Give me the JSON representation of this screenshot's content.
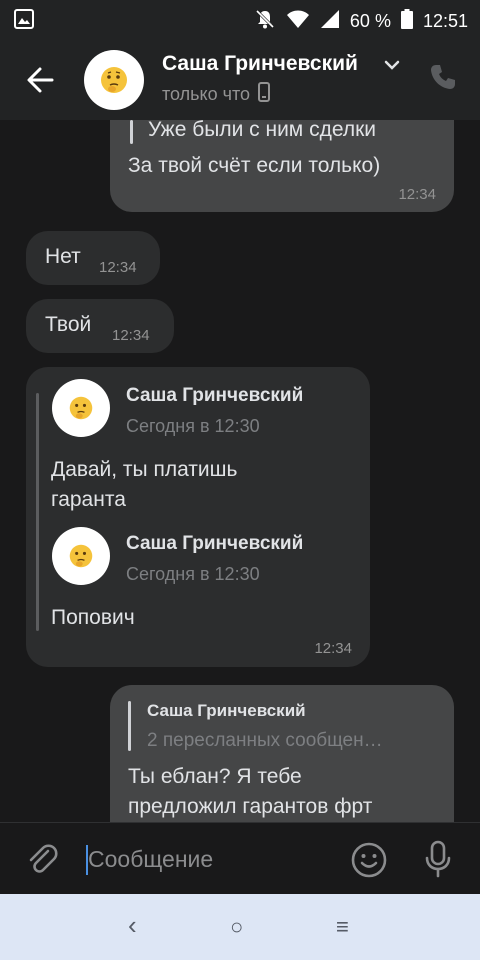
{
  "status_bar": {
    "battery": "60 %",
    "time": "12:51"
  },
  "header": {
    "contact_name": "Саша Гринчевский",
    "status": "только что"
  },
  "messages": {
    "m1": {
      "quote_text": "Уже были с ним сделки",
      "text": "За твой счёт если только)",
      "time": "12:34"
    },
    "m2": {
      "text": "Нет",
      "time": "12:34"
    },
    "m3": {
      "text": "Твой",
      "time": "12:34"
    },
    "m4": {
      "fwd1_name": "Саша Гринчевский",
      "fwd1_date": "Сегодня в 12:30",
      "fwd1_text_line1": "Давай, ты платишь",
      "fwd1_text_line2": "гаранта",
      "fwd2_name": "Саша Гринчевский",
      "fwd2_date": "Сегодня в 12:30",
      "fwd2_text": "Попович",
      "time": "12:34"
    },
    "m5": {
      "quote_name": "Саша Гринчевский",
      "quote_sub": "2 пересланных сообщен…",
      "text_line1": "Ты еблан? Я тебе",
      "text_line2": "предложил гарантов фрт"
    }
  },
  "composer": {
    "placeholder": "Сообщение"
  },
  "nav": {
    "back": "‹",
    "home": "○",
    "recents": "≡"
  },
  "colors": {
    "background": "#19191a",
    "header": "#222324",
    "bubble_out": "#454647",
    "bubble_in": "#2c2d2e",
    "navbar": "#dde6f5"
  }
}
